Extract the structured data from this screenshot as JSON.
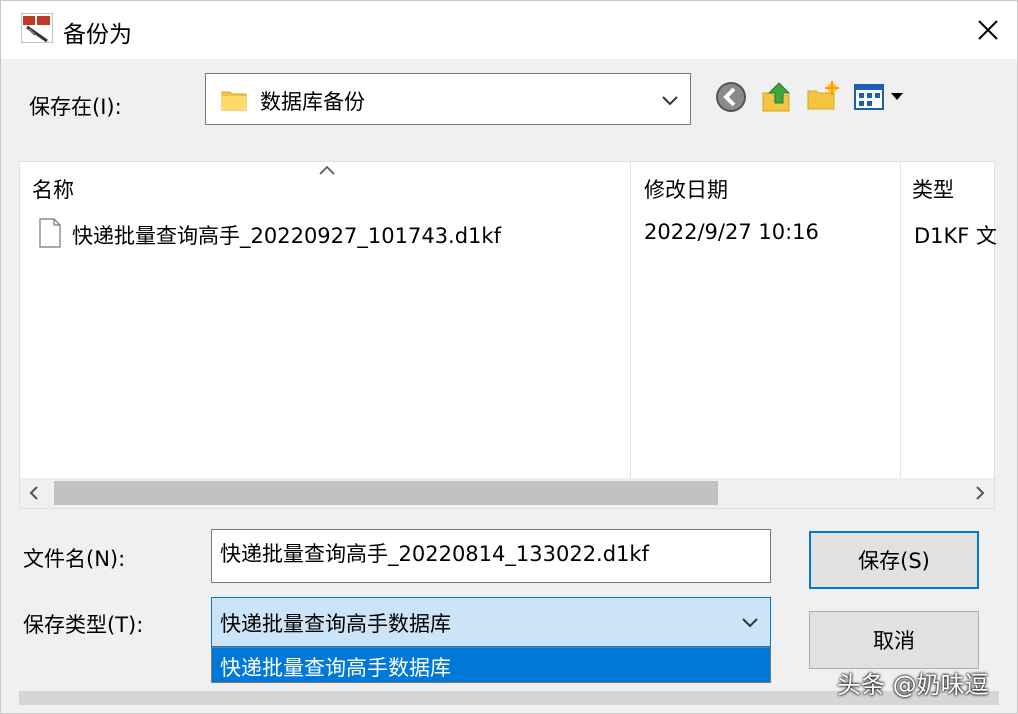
{
  "window": {
    "title": "备份为",
    "icon": "app-logo-icon",
    "close_icon": "close-icon"
  },
  "save_in": {
    "label": "保存在(I):",
    "value": "数据库备份",
    "folder_icon": "folder-icon"
  },
  "toolbar": {
    "icons": [
      "back-icon",
      "up-folder-icon",
      "new-folder-icon",
      "view-menu-icon"
    ]
  },
  "file_list": {
    "columns": [
      {
        "label": "名称"
      },
      {
        "label": "修改日期"
      },
      {
        "label": "类型"
      }
    ],
    "rows": [
      {
        "name": "快递批量查询高手_20220927_101743.d1kf",
        "date": "2022/9/27 10:16",
        "type": "D1KF 文"
      }
    ]
  },
  "filename": {
    "label": "文件名(N):",
    "value": "快递批量查询高手_20220814_133022.d1kf"
  },
  "filetype": {
    "label": "保存类型(T):",
    "value": "快递批量查询高手数据库",
    "options": [
      "快递批量查询高手数据库"
    ]
  },
  "buttons": {
    "save": "保存(S)",
    "cancel": "取消"
  },
  "watermark": "头条 @奶味逗",
  "colors": {
    "accent": "#0078d7",
    "selection_bg": "#cce4f7"
  }
}
